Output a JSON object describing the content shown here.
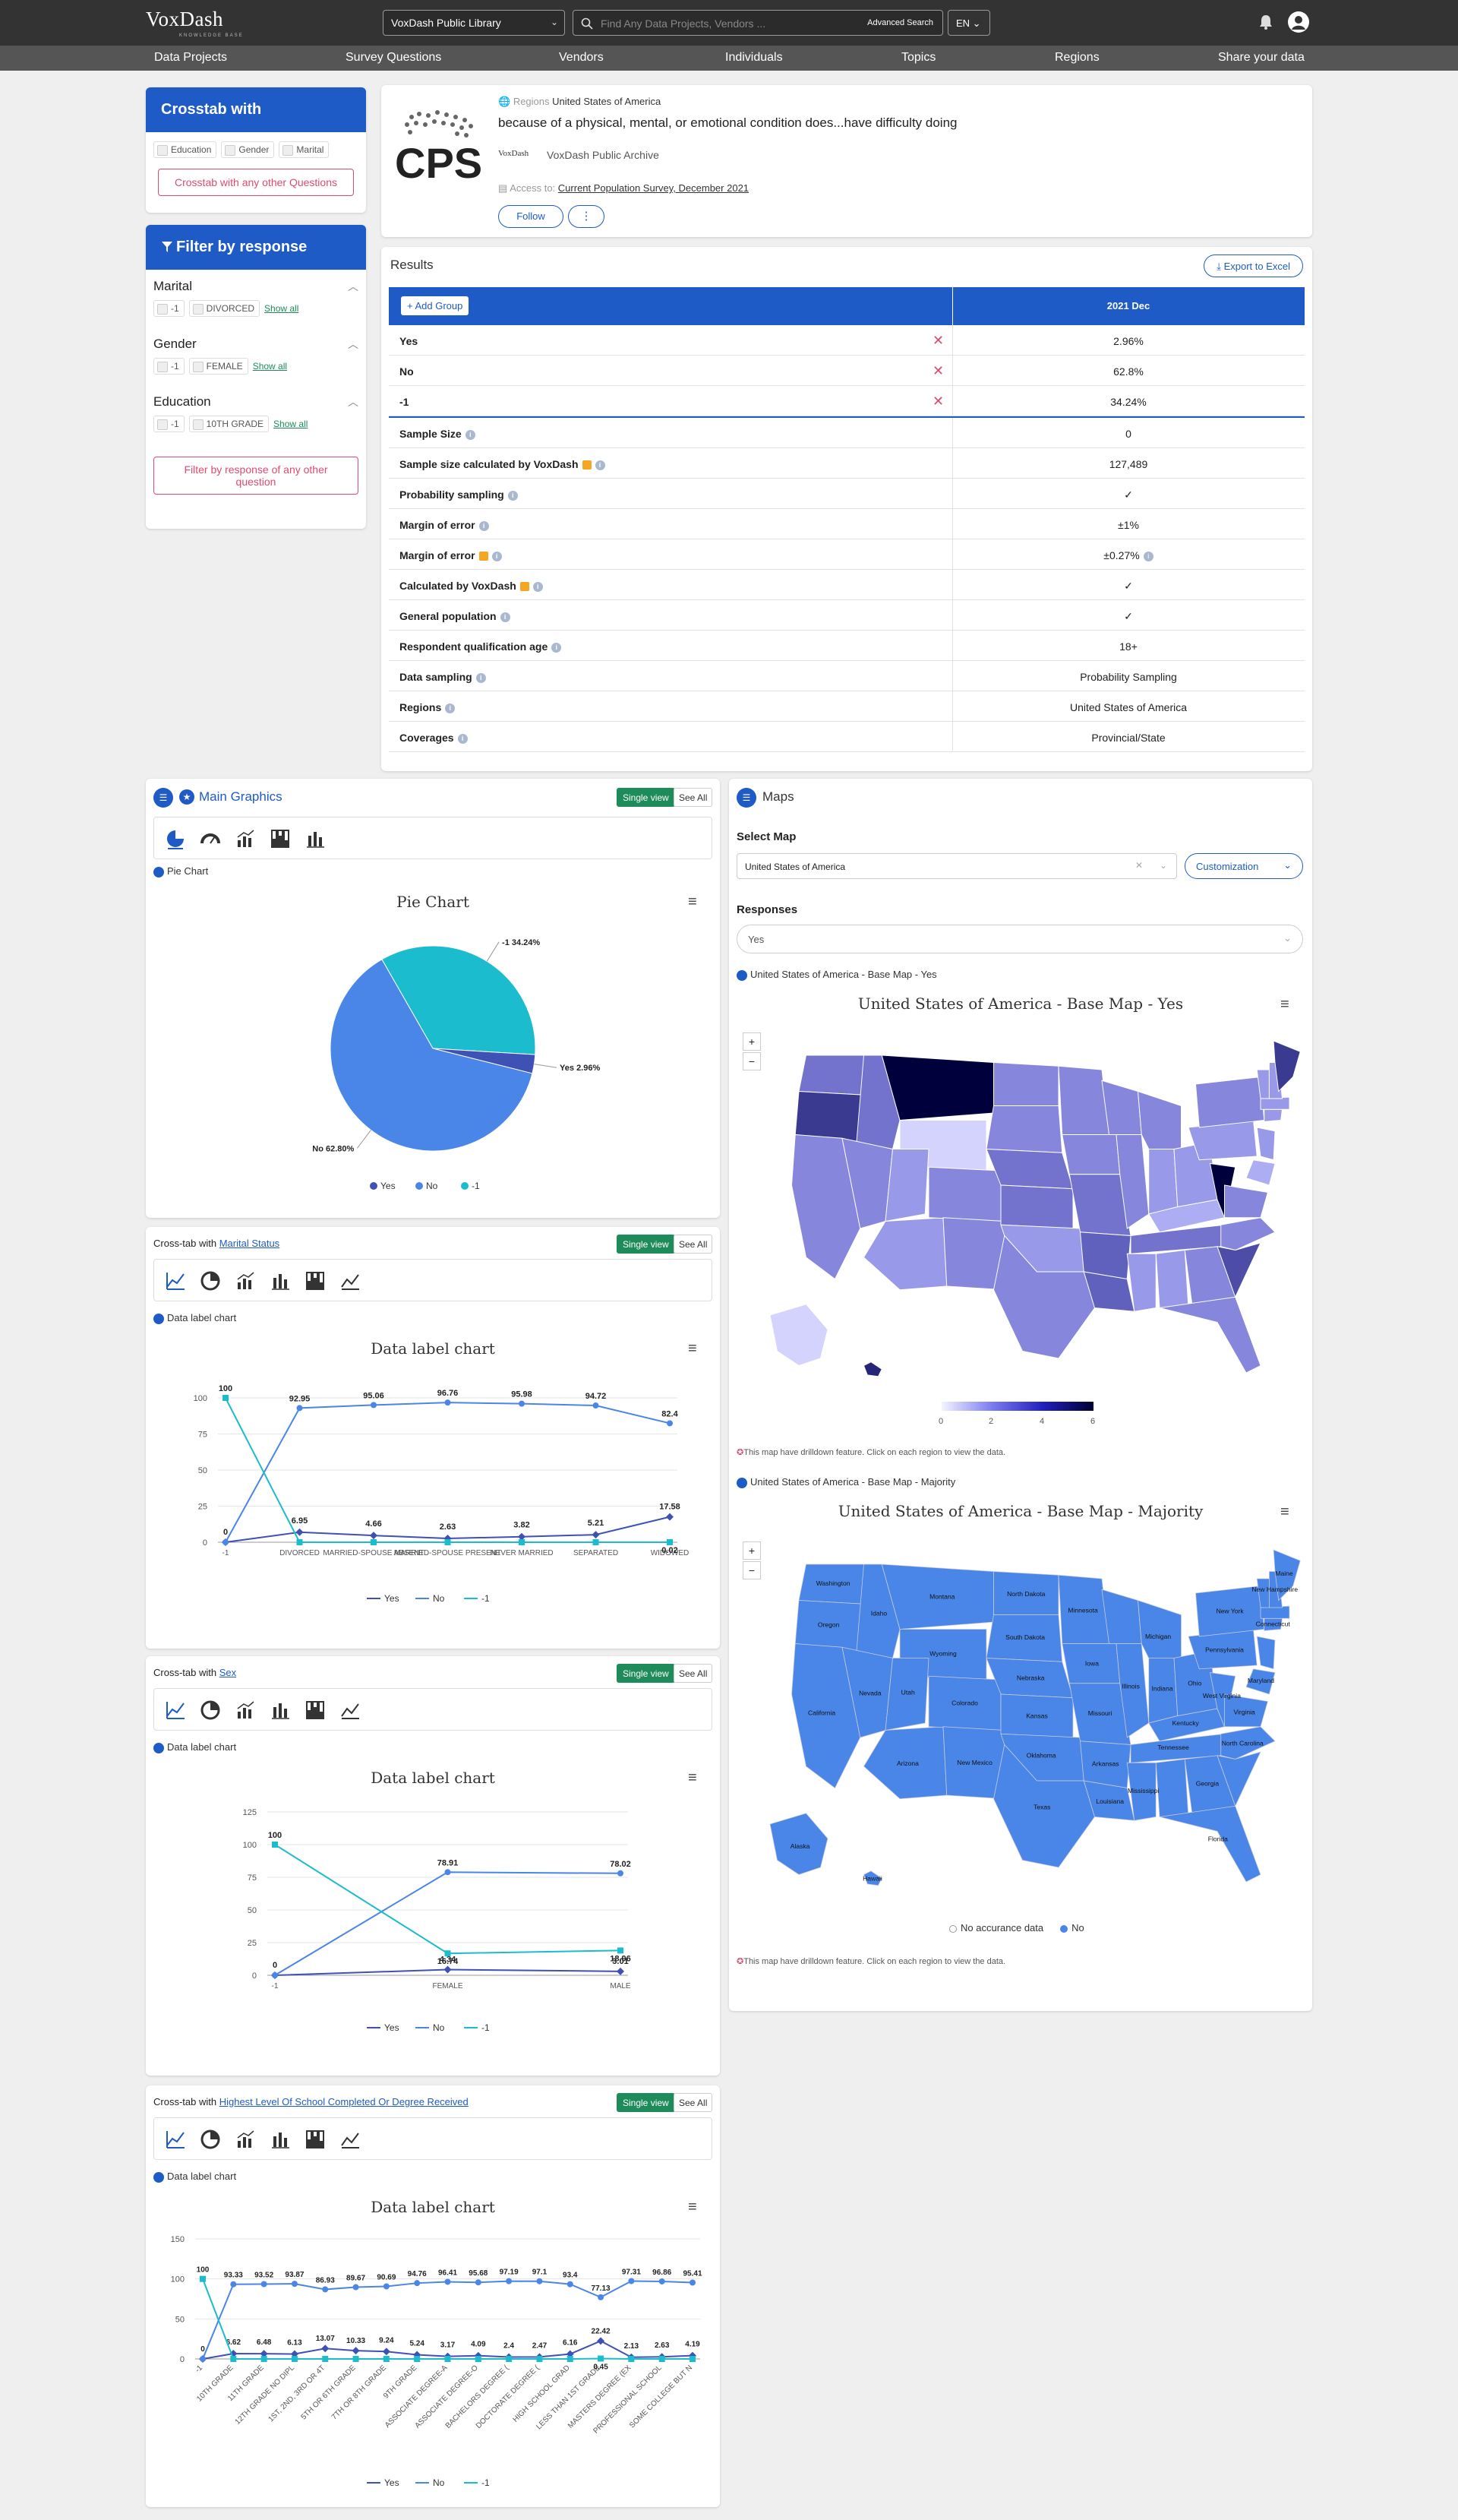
{
  "header": {
    "logo": "VoxDash",
    "logo_sub": "KNOWLEDGE BASE",
    "library": "VoxDash Public Library",
    "search_placeholder": "Find Any Data Projects, Vendors ...",
    "advanced_search": "Advanced Search",
    "language": "EN"
  },
  "nav": [
    "Data Projects",
    "Survey Questions",
    "Vendors",
    "Individuals",
    "Topics",
    "Regions",
    "Share your data"
  ],
  "crosstab": {
    "title": "Crosstab with",
    "chips": [
      "Education",
      "Gender",
      "Marital"
    ],
    "other_button": "Crosstab with any other Questions"
  },
  "filter": {
    "title": "Filter by response",
    "groups": [
      {
        "name": "Marital",
        "values": [
          "-1",
          "DIVORCED"
        ],
        "show_all": "Show all"
      },
      {
        "name": "Gender",
        "values": [
          "-1",
          "FEMALE"
        ],
        "show_all": "Show all"
      },
      {
        "name": "Education",
        "values": [
          "-1",
          "10TH GRADE"
        ],
        "show_all": "Show all"
      }
    ],
    "other_button": "Filter by response of any other question"
  },
  "question": {
    "region_label": "Regions",
    "region": "United States of America",
    "text": "because of a physical, mental, or emotional condition does...have difficulty doing",
    "archive_logo": "VoxDash",
    "archive": "VoxDash Public Archive",
    "access_label": "Access to:",
    "access_link": "Current Population Survey, December 2021",
    "follow": "Follow",
    "more": "⋮",
    "cps_logo": "CPS"
  },
  "results": {
    "title": "Results",
    "export": "Export to Excel",
    "add_group": "+ Add Group",
    "column": "2021 Dec",
    "answers": [
      {
        "label": "Yes",
        "value": "2.96%"
      },
      {
        "label": "No",
        "value": "62.8%"
      },
      {
        "label": "-1",
        "value": "34.24%"
      }
    ],
    "meta": [
      {
        "label": "Sample Size",
        "value": "0"
      },
      {
        "label": "Sample size calculated by VoxDash",
        "value": "127,489"
      },
      {
        "label": "Probability sampling",
        "value": "✓"
      },
      {
        "label": "Margin of error",
        "value": "±1%"
      },
      {
        "label": "Margin of error",
        "value": "±0.27%"
      },
      {
        "label": "Calculated by VoxDash",
        "value": "✓"
      },
      {
        "label": "General population",
        "value": "✓"
      },
      {
        "label": "Respondent qualification age",
        "value": "18+"
      },
      {
        "label": "Data sampling",
        "value": "Probability Sampling"
      },
      {
        "label": "Regions",
        "value": "United States of America"
      },
      {
        "label": "Coverages",
        "value": "Provincial/State"
      }
    ]
  },
  "main_graphics": {
    "title": "Main Graphics",
    "single_view": "Single view",
    "see_all": "See All",
    "sub": "Pie Chart",
    "chart_title": "Pie Chart"
  },
  "crosstabs": [
    {
      "prefix": "Cross-tab with ",
      "link": "Marital Status",
      "sub": "Data label chart",
      "chart_title": "Data label chart"
    },
    {
      "prefix": "Cross-tab with ",
      "link": "Sex",
      "sub": "Data label chart",
      "chart_title": "Data label chart"
    },
    {
      "prefix": "Cross-tab with ",
      "link": "Highest Level Of School Completed Or Degree Received",
      "sub": "Data label chart",
      "chart_title": "Data label chart"
    }
  ],
  "legend": {
    "yes": "Yes",
    "no": "No",
    "minus1": "-1"
  },
  "maps": {
    "title": "Maps",
    "select_map": "Select Map",
    "map_value": "United States of America",
    "customization": "Customization",
    "responses": "Responses",
    "response_value": "Yes",
    "map1_sub": "United States of America - Base Map - Yes",
    "map1_title": "United States of America - Base Map - Yes",
    "map1_scale": [
      "0",
      "2",
      "4",
      "6"
    ],
    "note": "This map have drilldown feature. Click on each region to view the data.",
    "map2_sub": "United States of America - Base Map - Majority",
    "map2_title": "United States of America - Base Map - Majority",
    "map2_legend": [
      "No accurance data",
      "No"
    ],
    "states": [
      "Washington",
      "Montana",
      "North Dakota",
      "Oregon",
      "Idaho",
      "South Dakota",
      "Minnesota",
      "Wyoming",
      "Nebraska",
      "Iowa",
      "Nevada",
      "Utah",
      "Colorado",
      "Kansas",
      "Missouri",
      "Illinois",
      "California",
      "Arizona",
      "New Mexico",
      "Oklahoma",
      "Arkansas",
      "Texas",
      "Louisiana",
      "Mississippi",
      "Tennessee",
      "Kentucky",
      "Ohio",
      "Michigan",
      "Indiana",
      "Georgia",
      "Florida",
      "North Carolina",
      "Virginia",
      "West Virginia",
      "Maryland",
      "Pennsylvania",
      "Connecticut",
      "New Hampshire",
      "New York",
      "Maine",
      "Alaska",
      "Hawaii"
    ]
  },
  "colors": {
    "primary": "#1e5bc6",
    "yes": "#3f51b5",
    "no": "#4a86e8",
    "minus1": "#1bbccd",
    "map_fill": "#4a86e8"
  },
  "chart_data": [
    {
      "type": "pie",
      "title": "Pie Chart",
      "categories": [
        "Yes",
        "No",
        "-1"
      ],
      "values": [
        2.96,
        62.8,
        34.24
      ],
      "labels": [
        "Yes 2.96%",
        "No 62.80%",
        "-1 34.24%"
      ]
    },
    {
      "type": "line",
      "title": "Data label chart",
      "categories": [
        "-1",
        "DIVORCED",
        "MARRIED-SPOUSE ABSENT",
        "MARRIED-SPOUSE PRESENT",
        "NEVER MARRIED",
        "SEPARATED",
        "WIDOWED"
      ],
      "ylim": [
        0,
        100
      ],
      "yticks": [
        "0",
        "25",
        "50",
        "75",
        "100"
      ],
      "series": [
        {
          "name": "Yes",
          "values": [
            0,
            6.95,
            4.66,
            2.63,
            3.82,
            5.21,
            17.58
          ]
        },
        {
          "name": "No",
          "values": [
            0,
            92.95,
            95.06,
            96.76,
            95.98,
            94.72,
            82.4
          ]
        },
        {
          "name": "-1",
          "values": [
            100,
            0,
            0,
            0,
            0,
            0,
            0.02
          ]
        }
      ],
      "point_labels": [
        [
          "0",
          "6.95",
          "4.66",
          "2.63",
          "3.82",
          "5.21",
          "17.58"
        ],
        [
          "",
          "92.95",
          "95.06",
          "96.76",
          "95.98",
          "94.72",
          "82.4"
        ],
        [
          "100",
          "",
          "",
          "",
          "",
          "",
          "0.02"
        ]
      ]
    },
    {
      "type": "line",
      "title": "Data label chart",
      "categories": [
        "-1",
        "FEMALE",
        "MALE"
      ],
      "ylim": [
        0,
        125
      ],
      "yticks": [
        "0",
        "25",
        "50",
        "75",
        "100",
        "125"
      ],
      "series": [
        {
          "name": "Yes",
          "values": [
            0,
            4.34,
            3.01
          ]
        },
        {
          "name": "No",
          "values": [
            0,
            78.91,
            78.02
          ]
        },
        {
          "name": "-1",
          "values": [
            100,
            16.74,
            18.96
          ]
        }
      ],
      "point_labels": [
        [
          "0",
          "4.34",
          "3.01"
        ],
        [
          "",
          "78.91",
          "78.02"
        ],
        [
          "100",
          "16.74",
          "18.96"
        ]
      ]
    },
    {
      "type": "line",
      "title": "Data label chart",
      "categories": [
        "-1",
        "10TH GRADE",
        "11TH GRADE",
        "12TH GRADE NO DIPL",
        "1ST, 2ND, 3RD OR 4T",
        "5TH OR 6TH GRADE",
        "7TH OR 8TH GRADE",
        "9TH GRADE",
        "ASSOCIATE DEGREE-A",
        "ASSOCIATE DEGREE-O",
        "BACHELORS DEGREE (",
        "DOCTORATE DEGREE (",
        "HIGH SCHOOL GRAD",
        "LESS THAN 1ST GRADE",
        "MASTERS DEGREE (EX",
        "PROFESSIONAL SCHOOL",
        "SOME COLLEGE BUT N"
      ],
      "ylim": [
        0,
        150
      ],
      "yticks": [
        "0",
        "50",
        "100",
        "150"
      ],
      "series": [
        {
          "name": "Yes",
          "values": [
            0,
            6.62,
            6.48,
            6.13,
            13.07,
            10.33,
            9.24,
            5.24,
            3.17,
            4.09,
            2.4,
            2.47,
            6.16,
            22.42,
            2.13,
            2.63,
            4.19
          ]
        },
        {
          "name": "No",
          "values": [
            0,
            93.33,
            93.52,
            93.87,
            86.93,
            89.67,
            90.69,
            94.76,
            96.41,
            95.68,
            97.19,
            97.1,
            93.4,
            77.13,
            97.31,
            96.86,
            95.41
          ]
        },
        {
          "name": "-1",
          "values": [
            100,
            0,
            0,
            0,
            0,
            0,
            0,
            0,
            0,
            0,
            0,
            0,
            0,
            0.45,
            0,
            0,
            0
          ]
        }
      ],
      "point_labels": [
        [
          "0",
          "6.62",
          "6.48",
          "6.13",
          "13.07",
          "10.33",
          "9.24",
          "5.24",
          "3.17",
          "4.09",
          "2.4",
          "2.47",
          "6.16",
          "22.42",
          "2.13",
          "2.63",
          "4.19"
        ],
        [
          "",
          "93.33",
          "93.52",
          "93.87",
          "86.93",
          "89.67",
          "90.69",
          "94.76",
          "96.41",
          "95.68",
          "97.19",
          "97.1",
          "93.4",
          "77.13",
          "97.31",
          "96.86",
          "95.41"
        ],
        [
          "100",
          "",
          "",
          "",
          "",
          "",
          "",
          "",
          "",
          "",
          "",
          "",
          "",
          "0.45",
          "",
          "",
          ""
        ]
      ]
    },
    {
      "type": "heatmap",
      "title": "United States of America - Base Map - Yes",
      "scale": [
        0,
        6
      ],
      "scale_ticks": [
        "0",
        "2",
        "4",
        "6"
      ]
    }
  ]
}
